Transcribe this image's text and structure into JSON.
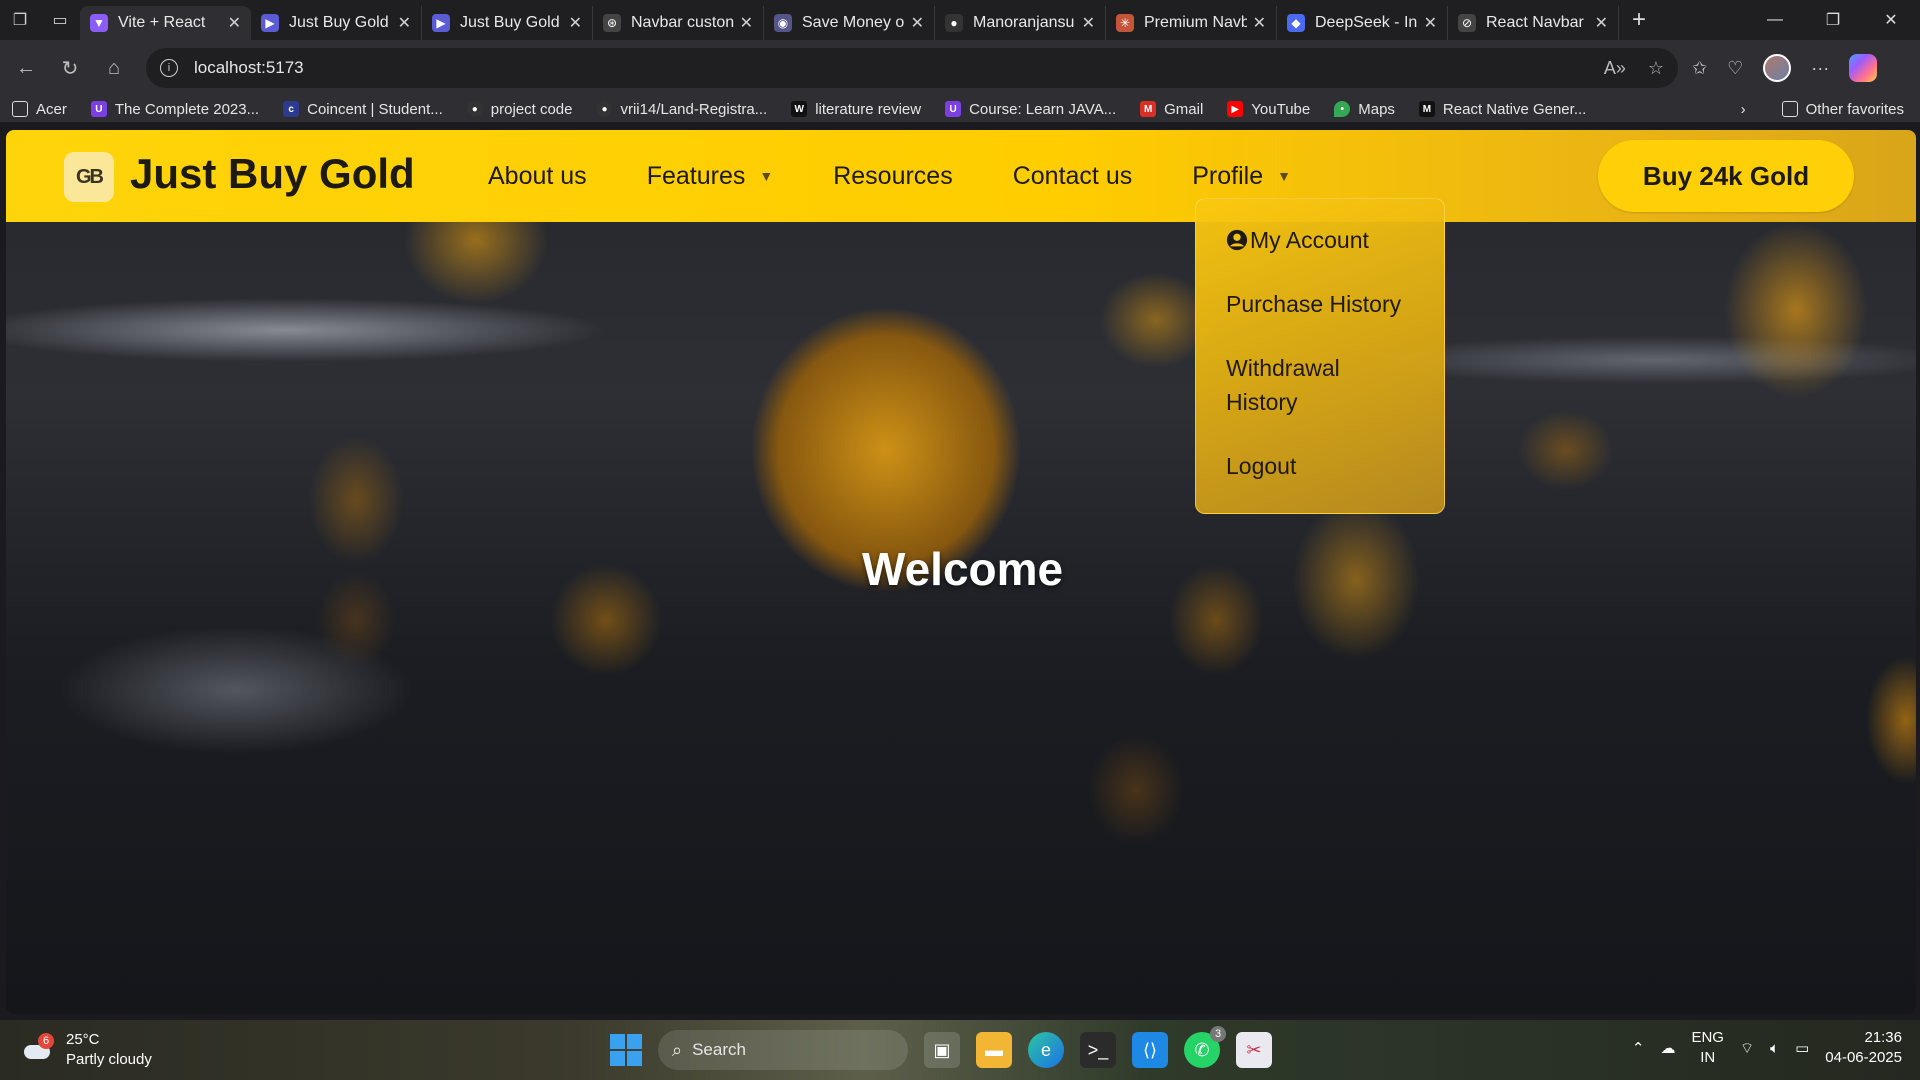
{
  "browser": {
    "tabs": [
      {
        "title": "Vite + React",
        "favicon_color": "#8b5cf6",
        "active": true
      },
      {
        "title": "Just Buy Gold",
        "favicon_color": "#5b5bd6",
        "active": false
      },
      {
        "title": "Just Buy Gold",
        "favicon_color": "#5b5bd6",
        "active": false
      },
      {
        "title": "Navbar custon",
        "favicon_color": "#444444",
        "active": false
      },
      {
        "title": "Save Money o",
        "favicon_color": "#55558a",
        "active": false
      },
      {
        "title": "Manoranjansu",
        "favicon_color": "#333333",
        "active": false
      },
      {
        "title": "Premium Navb",
        "favicon_color": "#c4553a",
        "active": false
      },
      {
        "title": "DeepSeek - In",
        "favicon_color": "#4a6bf0",
        "active": false
      },
      {
        "title": "React Navbar",
        "favicon_color": "#444444",
        "active": false
      }
    ],
    "url": "localhost:5173",
    "bookmarks": [
      {
        "label": "Acer",
        "color": "#555555",
        "glyph": ""
      },
      {
        "label": "The Complete 2023...",
        "color": "#7b3fe4",
        "glyph": "U"
      },
      {
        "label": "Coincent | Student...",
        "color": "#2b3b8f",
        "glyph": ""
      },
      {
        "label": "project code",
        "color": "#333333",
        "glyph": ""
      },
      {
        "label": "vrii14/Land-Registra...",
        "color": "#333333",
        "glyph": ""
      },
      {
        "label": "literature review",
        "color": "#111111",
        "glyph": "W"
      },
      {
        "label": "Course: Learn JAVA...",
        "color": "#7b3fe4",
        "glyph": "U"
      },
      {
        "label": "Gmail",
        "color": "#d93025",
        "glyph": "M"
      },
      {
        "label": "YouTube",
        "color": "#ff0000",
        "glyph": "▶"
      },
      {
        "label": "Maps",
        "color": "#34a853",
        "glyph": ""
      },
      {
        "label": "React Native Gener...",
        "color": "#111111",
        "glyph": "Mi"
      }
    ],
    "other_favorites": "Other favorites"
  },
  "site": {
    "logo_glyph": "GB",
    "brand": "Just Buy Gold",
    "nav": {
      "about": "About us",
      "features": "Features",
      "resources": "Resources",
      "contact": "Contact us",
      "profile": "Profile"
    },
    "cta": "Buy 24k Gold",
    "profile_menu": {
      "my_account": "My Account",
      "purchase_history": "Purchase History",
      "withdrawal_history": "Withdrawal History",
      "logout": "Logout"
    },
    "hero_text": "Welcome"
  },
  "taskbar": {
    "weather_temp": "25°C",
    "weather_desc": "Partly cloudy",
    "weather_badge": "6",
    "search_placeholder": "Search",
    "whatsapp_badge": "3",
    "lang_top": "ENG",
    "lang_bottom": "IN",
    "time": "21:36",
    "date": "04-06-2025"
  }
}
